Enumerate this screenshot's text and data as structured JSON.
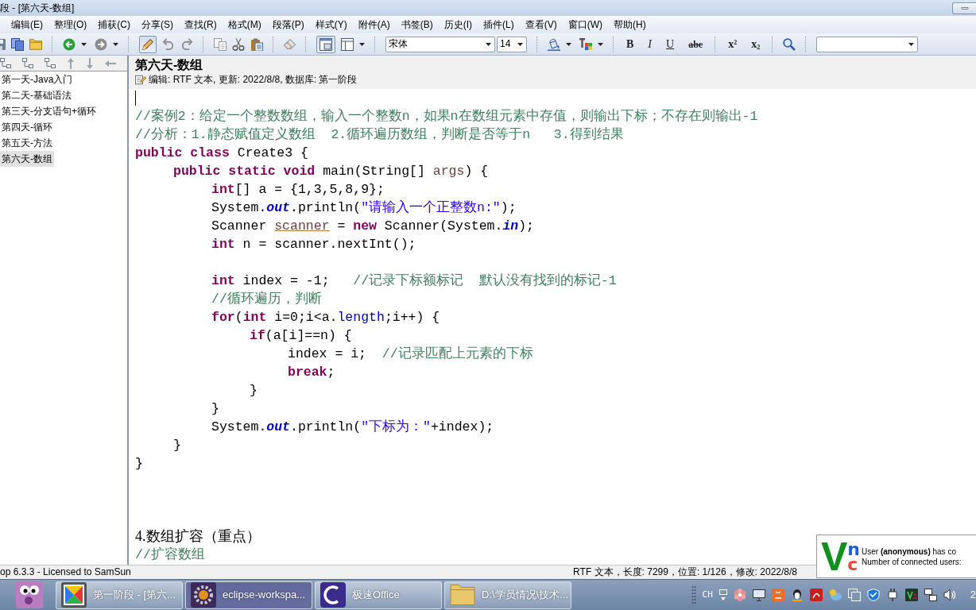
{
  "window": {
    "title": "段 - [第六天-数组]"
  },
  "menu": [
    "编辑(E)",
    "整理(O)",
    "捕获(C)",
    "分享(S)",
    "查找(R)",
    "格式(M)",
    "段落(P)",
    "样式(Y)",
    "附件(A)",
    "书签(B)",
    "历史(I)",
    "插件(L)",
    "查看(V)",
    "窗口(W)",
    "帮助(H)"
  ],
  "toolbar": {
    "edit_mode": {
      "pressed": true
    },
    "view_mode": {
      "pressed": true
    },
    "font": "宋体",
    "font_size": "14",
    "format_buttons": [
      {
        "kind": "bold",
        "label": "B"
      },
      {
        "kind": "italic",
        "label": "I"
      },
      {
        "kind": "underline",
        "label": "U"
      },
      {
        "kind": "strike",
        "label": "abc"
      },
      {
        "kind": "superscript",
        "label": "x$^{2}$"
      },
      {
        "kind": "subscript",
        "label": "x$_{2}$"
      }
    ]
  },
  "sidebar": {
    "items": [
      {
        "label": "第一天-Java入门",
        "selected": false
      },
      {
        "label": "第二天-基础语法",
        "selected": false
      },
      {
        "label": "第三天-分支语句+循环",
        "selected": false
      },
      {
        "label": "第四天-循环",
        "selected": false
      },
      {
        "label": "第五天-方法",
        "selected": false
      },
      {
        "label": "第六天-数组",
        "selected": true
      }
    ]
  },
  "document": {
    "title": "第六天-数组",
    "info": "编辑: RTF 文本, 更新: 2022/8/8, 数据库: 第一阶段",
    "lines": [
      {
        "kind": "cursor"
      },
      {
        "kind": "code",
        "tokens": [
          {
            "kind": "comment",
            "text": "//案例2：给定一个整数数组，输入一个整数n，如果n在数组元素中存值，则输出下标；不存在则输出-1"
          }
        ]
      },
      {
        "kind": "code",
        "tokens": [
          {
            "kind": "comment",
            "text": "//分析：1.静态赋值定义数组  2.循环遍历数组，判断是否等于n   3.得到结果"
          }
        ]
      },
      {
        "kind": "code",
        "tokens": [
          {
            "kind": "keyword",
            "text": "public class"
          },
          {
            "kind": "plain",
            "text": " Create3 {"
          }
        ],
        "children": [
          {
            "kind": "code",
            "tokens": [
              {
                "kind": "keyword",
                "text": "public static void"
              },
              {
                "kind": "plain",
                "text": " main(String[] "
              },
              {
                "kind": "param",
                "text": "args"
              },
              {
                "kind": "plain",
                "text": ") {"
              }
            ],
            "children": [
              {
                "kind": "code",
                "tokens": [
                  {
                    "kind": "keyword",
                    "text": "int"
                  },
                  {
                    "kind": "plain",
                    "text": "[] a = {1,3,5,8,9};"
                  }
                ]
              },
              {
                "kind": "code",
                "tokens": [
                  {
                    "kind": "plain",
                    "text": "System."
                  },
                  {
                    "kind": "static_field",
                    "text": "out"
                  },
                  {
                    "kind": "plain",
                    "text": ".println("
                  },
                  {
                    "kind": "string",
                    "text": "\"请输入一个正整数n:\""
                  },
                  {
                    "kind": "plain",
                    "text": ");"
                  }
                ]
              },
              {
                "kind": "code",
                "tokens": [
                  {
                    "kind": "plain",
                    "text": "Scanner "
                  },
                  {
                    "kind": "warning",
                    "text": "scanner"
                  },
                  {
                    "kind": "plain",
                    "text": " = "
                  },
                  {
                    "kind": "keyword",
                    "text": "new"
                  },
                  {
                    "kind": "plain",
                    "text": " Scanner(System."
                  },
                  {
                    "kind": "static_field",
                    "text": "in"
                  },
                  {
                    "kind": "plain",
                    "text": ");"
                  }
                ]
              },
              {
                "kind": "code",
                "tokens": [
                  {
                    "kind": "keyword",
                    "text": "int"
                  },
                  {
                    "kind": "plain",
                    "text": " n = scanner.nextInt();"
                  }
                ]
              },
              {
                "kind": "blank"
              },
              {
                "kind": "code",
                "tokens": [
                  {
                    "kind": "keyword",
                    "text": "int"
                  },
                  {
                    "kind": "plain",
                    "text": " index = -1;   "
                  },
                  {
                    "kind": "comment",
                    "text": "//记录下标额标记  默认没有找到的标记-1"
                  }
                ]
              },
              {
                "kind": "code",
                "tokens": [
                  {
                    "kind": "comment",
                    "text": "//循环遍历，判断"
                  }
                ]
              },
              {
                "kind": "code",
                "tokens": [
                  {
                    "kind": "keyword",
                    "text": "for"
                  },
                  {
                    "kind": "plain",
                    "text": "("
                  },
                  {
                    "kind": "keyword",
                    "text": "int"
                  },
                  {
                    "kind": "plain",
                    "text": " i=0;i<a."
                  },
                  {
                    "kind": "field",
                    "text": "length"
                  },
                  {
                    "kind": "plain",
                    "text": ";i++) {"
                  }
                ],
                "children": [
                  {
                    "kind": "code",
                    "tokens": [
                      {
                        "kind": "keyword",
                        "text": "if"
                      },
                      {
                        "kind": "plain",
                        "text": "(a[i]==n) {"
                      }
                    ],
                    "children": [
                      {
                        "kind": "code",
                        "tokens": [
                          {
                            "kind": "plain",
                            "text": "index = i;  "
                          },
                          {
                            "kind": "comment",
                            "text": "//记录匹配上元素的下标"
                          }
                        ]
                      },
                      {
                        "kind": "code",
                        "tokens": [
                          {
                            "kind": "keyword",
                            "text": "break"
                          },
                          {
                            "kind": "plain",
                            "text": ";"
                          }
                        ]
                      }
                    ]
                  },
                  {
                    "kind": "code",
                    "tokens": [
                      {
                        "kind": "plain",
                        "text": "}"
                      }
                    ]
                  }
                ]
              },
              {
                "kind": "code",
                "tokens": [
                  {
                    "kind": "plain",
                    "text": "}"
                  }
                ]
              },
              {
                "kind": "code",
                "tokens": [
                  {
                    "kind": "plain",
                    "text": "System."
                  },
                  {
                    "kind": "static_field",
                    "text": "out"
                  },
                  {
                    "kind": "plain",
                    "text": ".println("
                  },
                  {
                    "kind": "string",
                    "text": "\"下标为：\""
                  },
                  {
                    "kind": "plain",
                    "text": "+index);"
                  }
                ]
              }
            ]
          },
          {
            "kind": "code",
            "tokens": [
              {
                "kind": "plain",
                "text": "}"
              }
            ]
          }
        ]
      },
      {
        "kind": "code",
        "tokens": [
          {
            "kind": "plain",
            "text": "}"
          }
        ]
      },
      {
        "kind": "blank"
      },
      {
        "kind": "blank"
      },
      {
        "kind": "blank"
      },
      {
        "kind": "heading",
        "text": "4.数组扩容（重点）"
      },
      {
        "kind": "code",
        "tokens": [
          {
            "kind": "comment",
            "text": "//扩容数组"
          }
        ]
      }
    ]
  },
  "status_bar": {
    "left": "op 6.3.3 - Licensed to SamSun",
    "right": "RTF 文本，长度: 7299，位置: 1/126，修改: 2022/8/8"
  },
  "notification": {
    "logo": [
      {
        "text": "V",
        "color": "#10911f"
      },
      {
        "text": "n",
        "color": "#1f5fd8"
      },
      {
        "text": "c",
        "color": "#e4473c"
      }
    ],
    "lines": [
      "User **(anonymous)** has co",
      "Number of connected users:"
    ]
  },
  "taskbar": {
    "tasks": [
      {
        "label": "第一阶段 - [第六...",
        "selected": false
      },
      {
        "label": "eclipse-workspa...",
        "selected": true
      },
      {
        "label": "极速Office",
        "selected": false
      },
      {
        "label": "D:\\学员情况\\技术...",
        "selected": false
      }
    ],
    "language": "CH",
    "clock": "2"
  }
}
